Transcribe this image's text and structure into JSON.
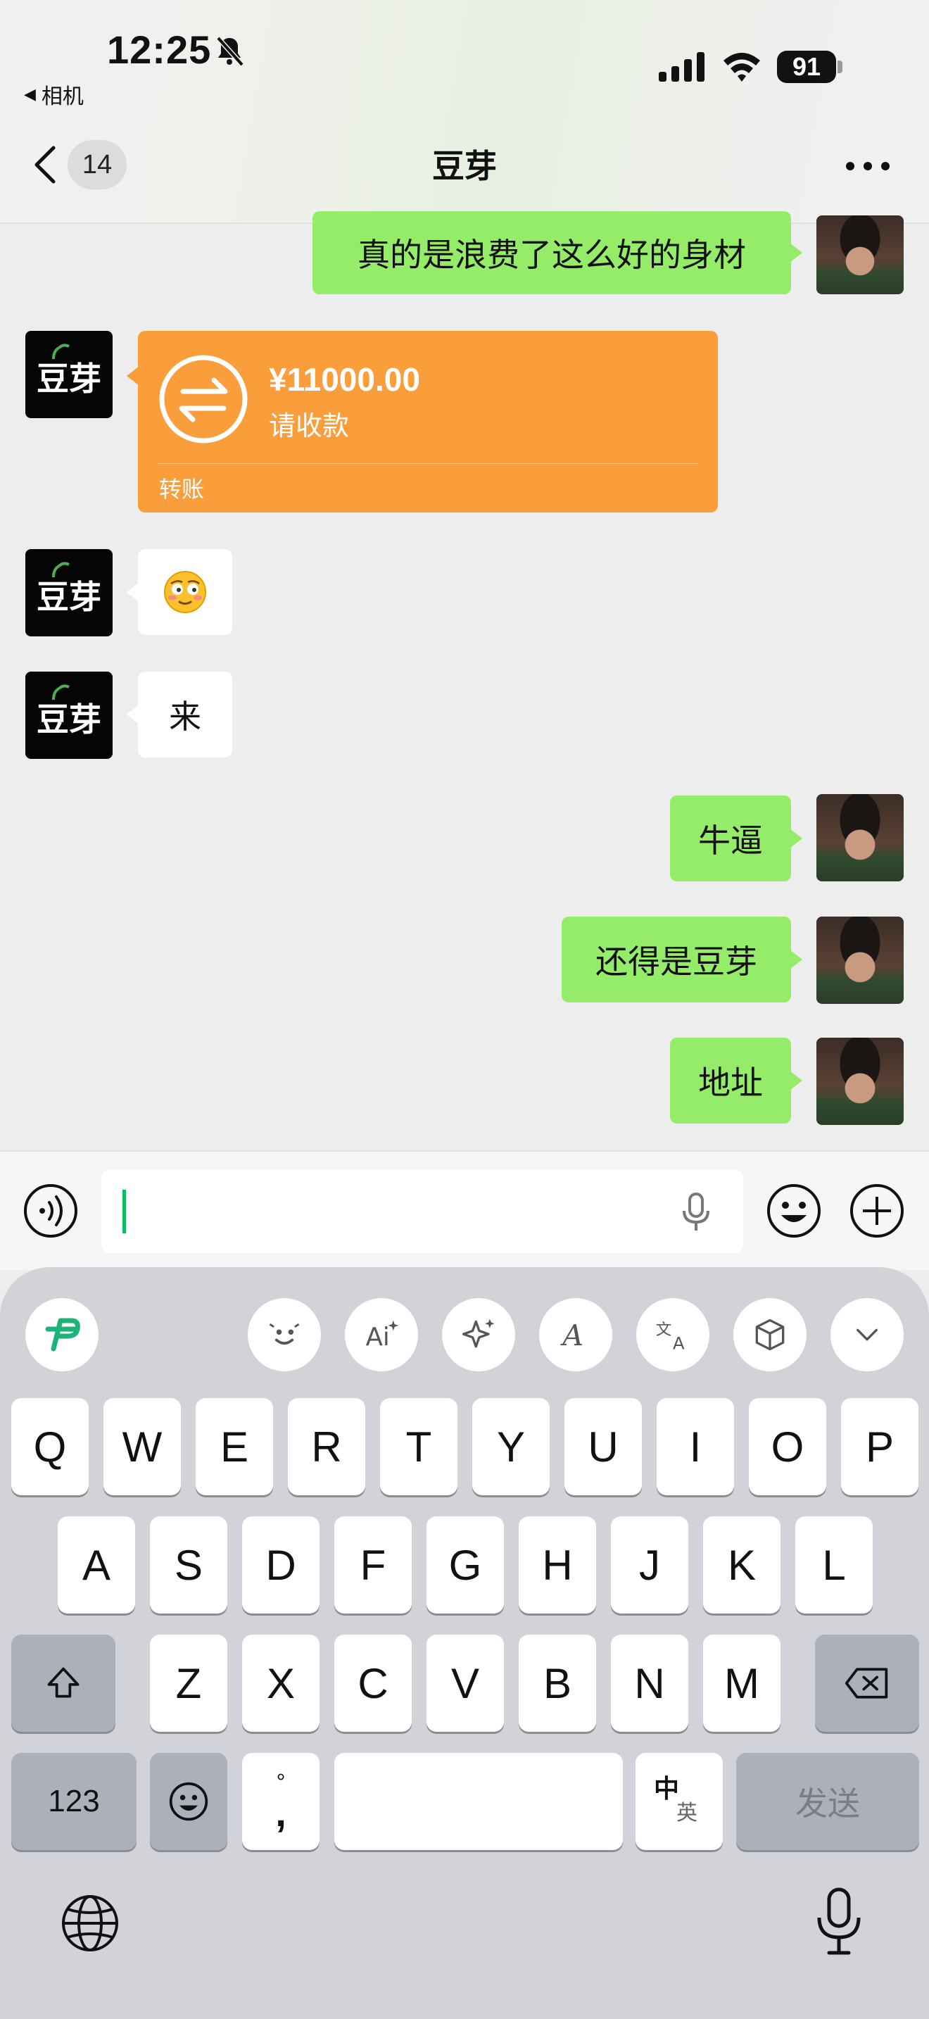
{
  "status_bar": {
    "time": "12:25",
    "back_app": "相机",
    "battery": "91"
  },
  "nav": {
    "unread_count": "14",
    "title": "豆芽"
  },
  "messages": [
    {
      "sender": "me",
      "text": "真的是浪费了这么好的身材"
    },
    {
      "sender": "douya",
      "type": "transfer",
      "amount": "¥11000.00",
      "status": "请收款",
      "label": "转账"
    },
    {
      "sender": "douya",
      "type": "emoji",
      "text": "😳"
    },
    {
      "sender": "douya",
      "text": "来"
    },
    {
      "sender": "me",
      "text": "牛逼"
    },
    {
      "sender": "me",
      "text": "还得是豆芽"
    },
    {
      "sender": "me",
      "text": "地址"
    }
  ],
  "input": {
    "value": ""
  },
  "keyboard": {
    "toolbar": [
      "logo-icon",
      "emoji-face-icon",
      "ai-icon",
      "sparkle-icon",
      "script-a-icon",
      "translate-icon",
      "cube-icon",
      "chevron-down-icon"
    ],
    "row1": [
      "Q",
      "W",
      "E",
      "R",
      "T",
      "Y",
      "U",
      "I",
      "O",
      "P"
    ],
    "row2": [
      "A",
      "S",
      "D",
      "F",
      "G",
      "H",
      "J",
      "K",
      "L"
    ],
    "row3": [
      "Z",
      "X",
      "C",
      "V",
      "B",
      "N",
      "M"
    ],
    "numbers_key": "123",
    "punct_top": "°",
    "punct_bottom": ",",
    "lang_main": "中",
    "lang_alt": "英",
    "send_key": "发送"
  },
  "colors": {
    "green_bubble": "#95ec69",
    "transfer_orange": "#fa9d3b",
    "caret": "#07c160"
  }
}
